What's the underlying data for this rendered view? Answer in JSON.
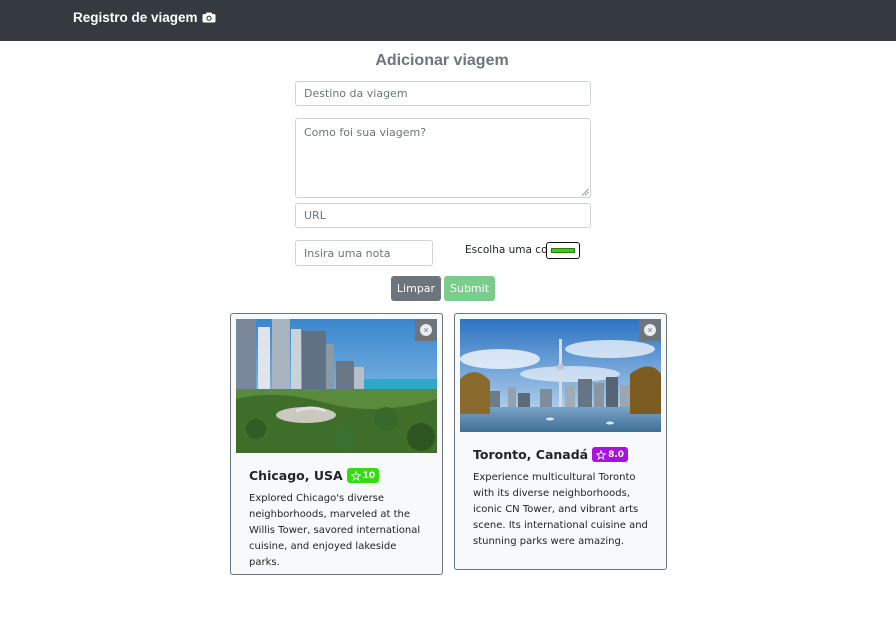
{
  "navbar": {
    "brand": "Registro de viagem",
    "brand_icon": "camera-icon"
  },
  "form": {
    "title": "Adicionar viagem",
    "destination_placeholder": "Destino da viagem",
    "description_placeholder": "Como foi sua viagem?",
    "url_placeholder": "URL",
    "rating_placeholder": "Insira uma nota",
    "color_label": "Escolha uma cor:",
    "color_value": "#44cc11",
    "clear_label": "Limpar",
    "submit_label": "Submit"
  },
  "cards": [
    {
      "title": "Chicago, USA",
      "rating": "10",
      "badge_color": "#33dd11",
      "text": "Explored Chicago's diverse neighborhoods, marveled at the Willis Tower, savored international cuisine, and enjoyed lakeside parks."
    },
    {
      "title": "Toronto, Canadá",
      "rating": "8.0",
      "badge_color": "#aa11dd",
      "text": "Experience multicultural Toronto with its diverse neighborhoods, iconic CN Tower, and vibrant arts scene. Its international cuisine and stunning parks were amazing."
    }
  ]
}
